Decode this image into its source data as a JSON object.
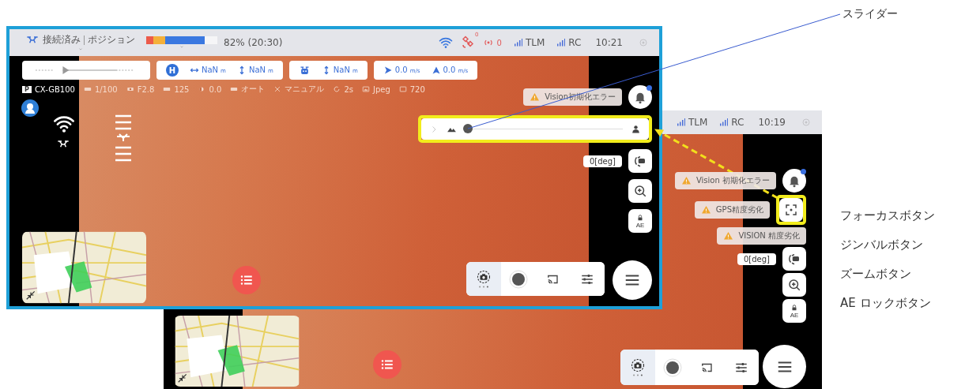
{
  "annotations": {
    "slider_label": "スライダー",
    "button_labels": [
      {
        "text": "フォーカスボタン"
      },
      {
        "text": "ジンバルボタン"
      },
      {
        "text": "ズームボタン"
      },
      {
        "text": "AE ロックボタン"
      }
    ]
  },
  "back_screen": {
    "status_bar": {
      "signals": [
        {
          "label": "TLM"
        },
        {
          "label": "RC"
        }
      ],
      "time": "10:19"
    },
    "right_panel": [
      {
        "items": [
          {
            "kind": "toast",
            "text": "Vision 初期化エラー"
          },
          {
            "kind": "bell",
            "notification": true,
            "highlighted": false
          }
        ]
      },
      {
        "items": [
          {
            "kind": "toast",
            "text": "GPS精度劣化"
          },
          {
            "kind": "focus",
            "highlighted": true
          }
        ]
      },
      {
        "items": [
          {
            "kind": "toast",
            "text": "VISION 精度劣化"
          }
        ]
      },
      {
        "items": [
          {
            "kind": "angle",
            "text": "0[deg]"
          },
          {
            "kind": "gimbal",
            "highlighted": false
          }
        ]
      },
      {
        "items": [
          {
            "kind": "zoom",
            "highlighted": false
          }
        ]
      },
      {
        "items": [
          {
            "kind": "ae",
            "label": "AE",
            "highlighted": false
          }
        ]
      }
    ],
    "bottom_bar": [
      {
        "kind": "camera",
        "selected": true
      },
      {
        "kind": "record",
        "selected": false
      },
      {
        "kind": "cast",
        "selected": false
      },
      {
        "kind": "settings",
        "selected": false
      }
    ]
  },
  "front_screen": {
    "status_bar": {
      "connection": "接続済み",
      "mode": "ポジション",
      "battery": {
        "level": 0.82,
        "reading": "82% (20:30)"
      },
      "satellites": "0",
      "rtk": "0",
      "signals": [
        {
          "label": "TLM"
        },
        {
          "label": "RC"
        }
      ],
      "time": "10:21"
    },
    "telemetry": [
      {
        "kind": "gauge"
      },
      {
        "kind": "home",
        "badge": "H",
        "readings": [
          {
            "value": "NaN",
            "unit": "m"
          },
          {
            "value": "NaN",
            "unit": "m"
          }
        ]
      },
      {
        "kind": "drone",
        "readings": [
          {
            "value": "NaN",
            "unit": "m"
          }
        ]
      },
      {
        "kind": "speed",
        "readings": [
          {
            "value": "0.0",
            "unit": "m/s"
          },
          {
            "value": "0.0",
            "unit": "m/s"
          }
        ]
      }
    ],
    "camera_settings": [
      {
        "kind": "camera",
        "badge": "P",
        "text": "CX-GB100"
      },
      {
        "kind": "shutter",
        "text": "1/100"
      },
      {
        "kind": "aperture",
        "text": "F2.8"
      },
      {
        "kind": "iso",
        "text": "125"
      },
      {
        "kind": "ev",
        "text": "0.0"
      },
      {
        "kind": "wb",
        "text": "オート"
      },
      {
        "kind": "focus",
        "text": "マニュアル"
      },
      {
        "kind": "timer",
        "text": "2s"
      },
      {
        "kind": "format",
        "text": "Jpeg"
      },
      {
        "kind": "resolution",
        "text": "720"
      }
    ],
    "right_panel": [
      {
        "items": [
          {
            "kind": "toast",
            "text": "Vision初期化エラー"
          },
          {
            "kind": "bell",
            "notification": true,
            "highlighted": false
          }
        ]
      },
      {
        "items": [
          {
            "kind": "slider",
            "level": 0,
            "highlighted": true
          }
        ]
      },
      {
        "items": [
          {
            "kind": "angle",
            "text": "0[deg]"
          },
          {
            "kind": "gimbal",
            "highlighted": false
          }
        ]
      },
      {
        "items": [
          {
            "kind": "zoom",
            "highlighted": false
          }
        ]
      },
      {
        "items": [
          {
            "kind": "ae",
            "label": "AE",
            "highlighted": false
          }
        ]
      }
    ],
    "bottom_bar": [
      {
        "kind": "camera",
        "selected": true
      },
      {
        "kind": "record",
        "selected": false
      },
      {
        "kind": "cast",
        "selected": false
      },
      {
        "kind": "settings",
        "selected": false
      }
    ]
  }
}
